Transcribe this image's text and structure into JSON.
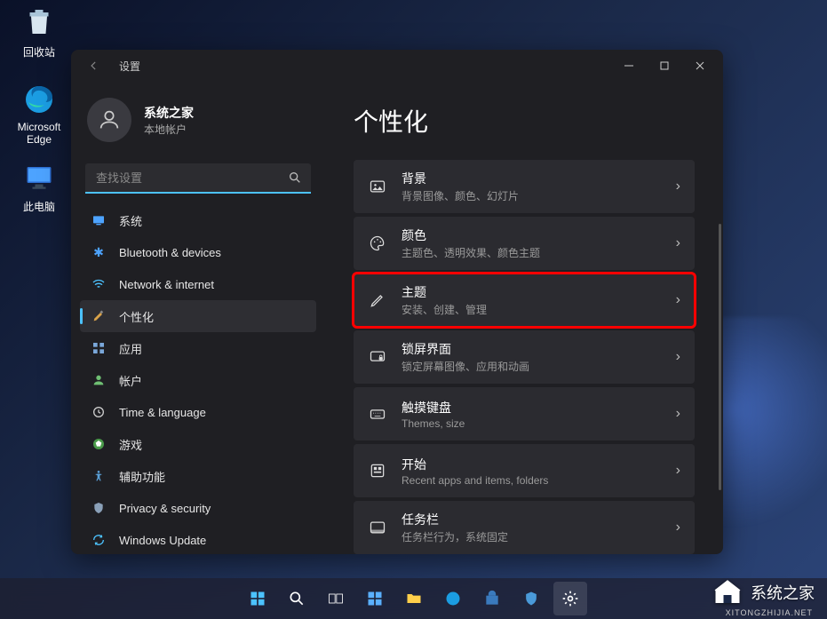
{
  "desktop": {
    "recycle": "回收站",
    "edge_line1": "Microsoft",
    "edge_line2": "Edge",
    "pc": "此电脑"
  },
  "settings": {
    "app_title": "设置",
    "profile": {
      "name": "系统之家",
      "sub": "本地帐户"
    },
    "search_placeholder": "查找设置",
    "nav": {
      "system": "系统",
      "bluetooth": "Bluetooth & devices",
      "network": "Network & internet",
      "personalization": "个性化",
      "apps": "应用",
      "accounts": "帐户",
      "time": "Time & language",
      "gaming": "游戏",
      "accessibility": "辅助功能",
      "privacy": "Privacy & security",
      "update": "Windows Update"
    },
    "page_title": "个性化",
    "cards": {
      "background": {
        "title": "背景",
        "sub": "背景图像、颜色、幻灯片"
      },
      "colors": {
        "title": "颜色",
        "sub": "主题色、透明效果、颜色主题"
      },
      "themes": {
        "title": "主题",
        "sub": "安装、创建、管理"
      },
      "lockscreen": {
        "title": "锁屏界面",
        "sub": "锁定屏幕图像、应用和动画"
      },
      "touchkb": {
        "title": "触摸键盘",
        "sub": "Themes, size"
      },
      "start": {
        "title": "开始",
        "sub": "Recent apps and items, folders"
      },
      "taskbar": {
        "title": "任务栏",
        "sub": "任务栏行为，系统固定"
      }
    }
  },
  "watermark": {
    "text": "系统之家",
    "sub": "XITONGZHIJIA.NET"
  }
}
